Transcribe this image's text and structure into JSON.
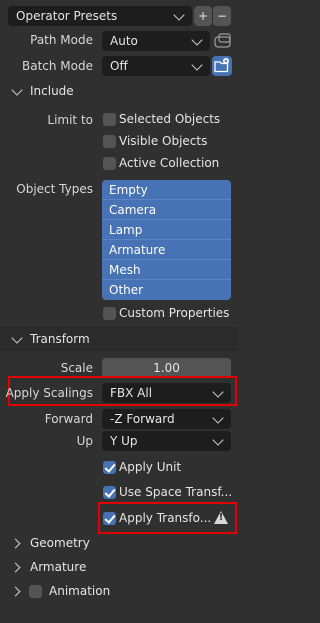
{
  "presets": {
    "label": "Operator Presets",
    "add": "+",
    "remove": "−"
  },
  "path_mode": {
    "label": "Path Mode",
    "value": "Auto"
  },
  "batch_mode": {
    "label": "Batch Mode",
    "value": "Off"
  },
  "include": {
    "header": "Include",
    "limit_label": "Limit to",
    "limits": [
      {
        "label": "Selected Objects",
        "checked": false
      },
      {
        "label": "Visible Objects",
        "checked": false
      },
      {
        "label": "Active Collection",
        "checked": false
      }
    ],
    "object_types_label": "Object Types",
    "object_types": [
      "Empty",
      "Camera",
      "Lamp",
      "Armature",
      "Mesh",
      "Other"
    ],
    "custom_properties": "Custom Properties"
  },
  "transform": {
    "header": "Transform",
    "scale_label": "Scale",
    "scale_value": "1.00",
    "apply_scalings_label": "Apply Scalings",
    "apply_scalings_value": "FBX All",
    "forward_label": "Forward",
    "forward_value": "-Z Forward",
    "up_label": "Up",
    "up_value": "Y Up",
    "apply_unit": "Apply Unit",
    "use_space_transform": "Use Space Transf...",
    "apply_transform": "Apply Transfo...",
    "warning_icon": "!"
  },
  "sections": {
    "geometry": "Geometry",
    "armature": "Armature",
    "animation": "Animation"
  },
  "colors": {
    "accent": "#4772b3",
    "highlight": "#e30000",
    "background": "#303030"
  }
}
